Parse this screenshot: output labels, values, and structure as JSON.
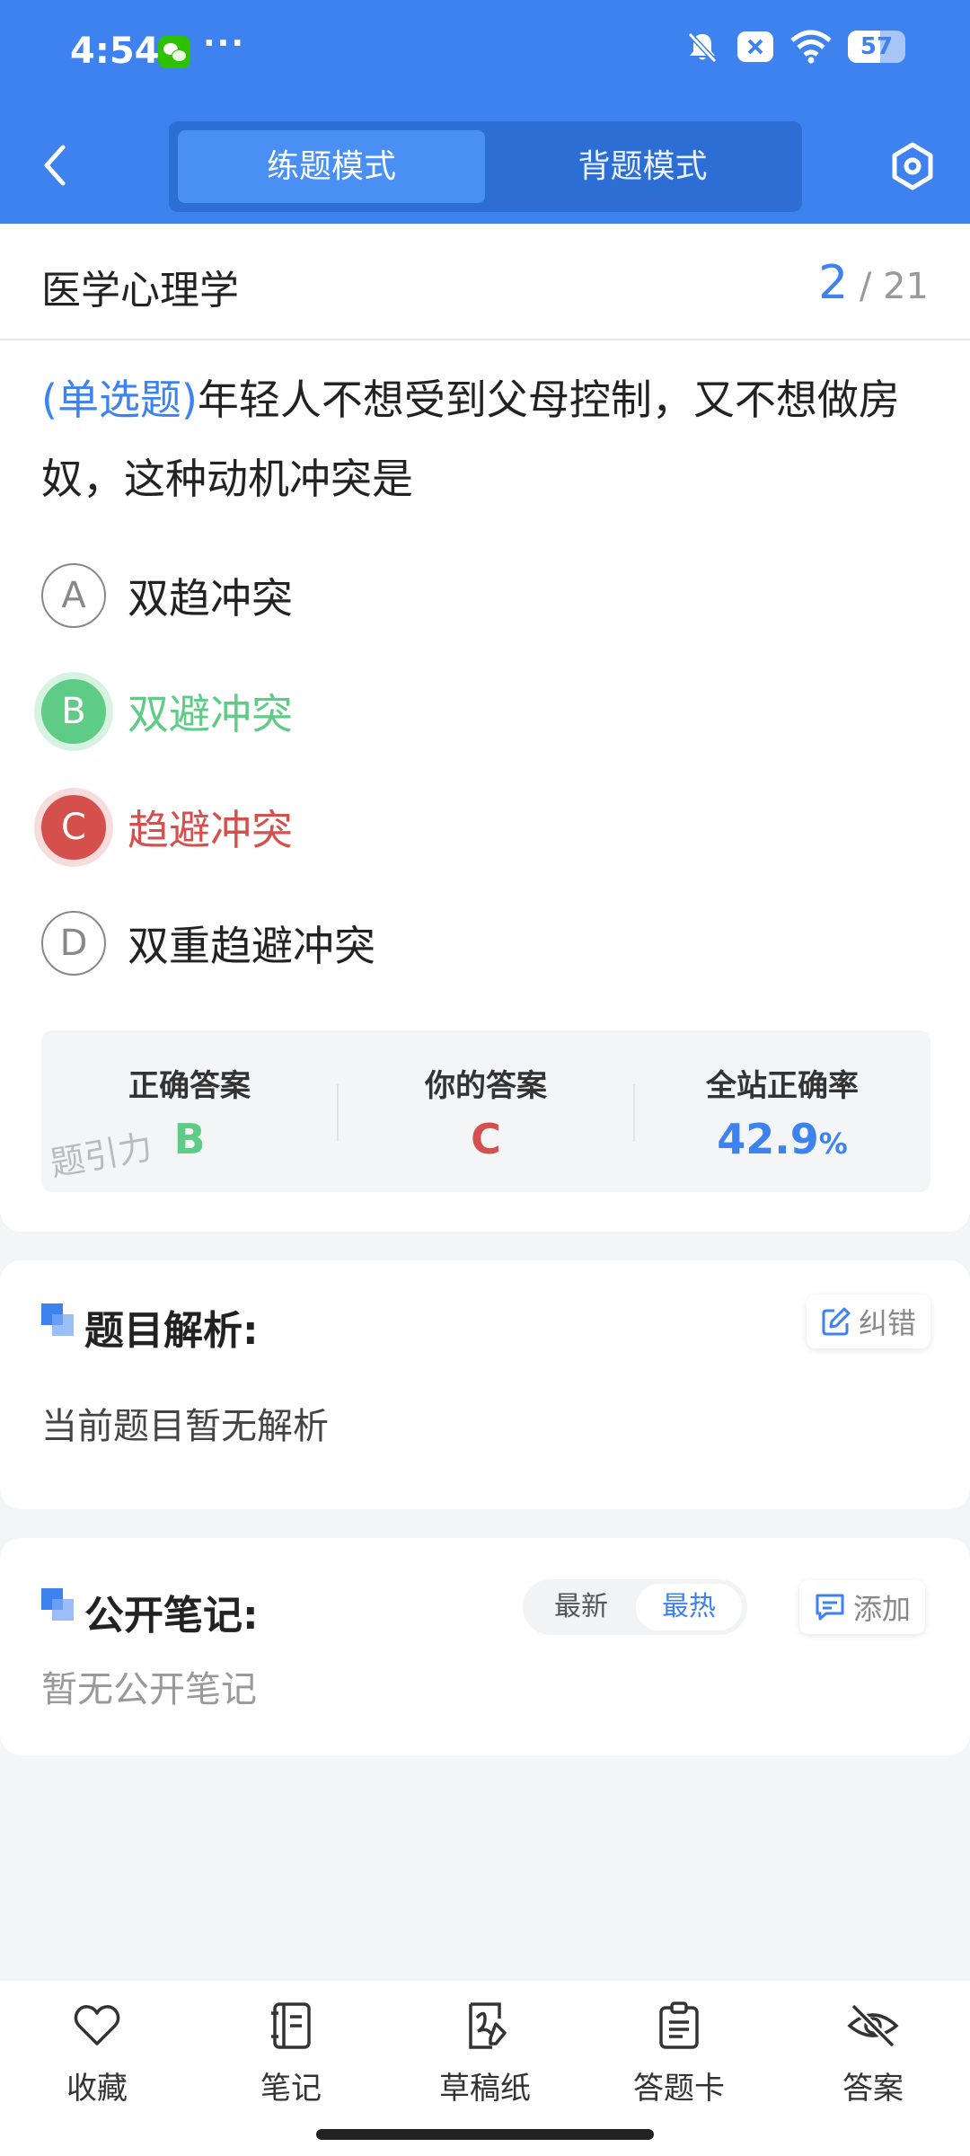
{
  "status_bar": {
    "time": "4:54",
    "dots": "···",
    "battery": "57",
    "battery_level": 0.57,
    "app_icon": "wechat-icon"
  },
  "header": {
    "tabs": [
      {
        "label": "练题模式",
        "active": true
      },
      {
        "label": "背题模式",
        "active": false
      }
    ],
    "back_icon": "chevron-left-icon",
    "settings_icon": "hexagon-settings-icon"
  },
  "subject": {
    "title": "医学心理学",
    "current": "2",
    "separator": " / ",
    "total": "21"
  },
  "question": {
    "type_tag": "(单选题)",
    "text": "年轻人不想受到父母控制，又不想做房奴，这种动机冲突是"
  },
  "options": [
    {
      "letter": "A",
      "text": "双趋冲突",
      "state": "normal"
    },
    {
      "letter": "B",
      "text": "双避冲突",
      "state": "correct"
    },
    {
      "letter": "C",
      "text": "趋避冲突",
      "state": "wrong"
    },
    {
      "letter": "D",
      "text": "双重趋避冲突",
      "state": "normal"
    }
  ],
  "stats": {
    "correct_label": "正确答案",
    "correct_value": "B",
    "yours_label": "你的答案",
    "yours_value": "C",
    "rate_label": "全站正确率",
    "rate_value": "42.9",
    "rate_unit": "%",
    "watermark": "题引力"
  },
  "analysis": {
    "title": "题目解析:",
    "body": "当前题目暂无解析",
    "report_label": "纠错"
  },
  "notes": {
    "title": "公开笔记:",
    "sort_latest": "最新",
    "sort_hottest": "最热",
    "add_label": "添加",
    "empty": "暂无公开笔记"
  },
  "bottom_nav": [
    {
      "label": "收藏",
      "icon": "heart-icon"
    },
    {
      "label": "笔记",
      "icon": "notebook-icon"
    },
    {
      "label": "草稿纸",
      "icon": "draft-paper-icon"
    },
    {
      "label": "答题卡",
      "icon": "clipboard-icon"
    },
    {
      "label": "答案",
      "icon": "eye-off-icon"
    }
  ],
  "colors": {
    "primary": "#3d82ee",
    "correct": "#5ecb86",
    "wrong": "#d5504c"
  }
}
